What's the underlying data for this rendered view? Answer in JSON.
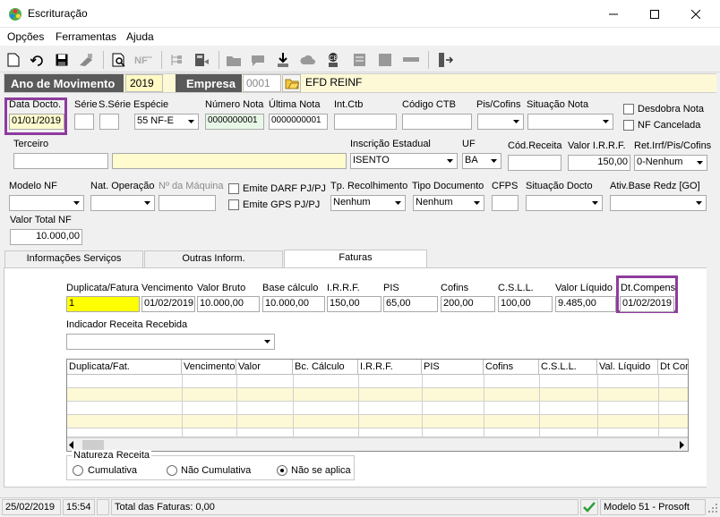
{
  "window": {
    "title": "Escrituração"
  },
  "menu": {
    "items": [
      "Opções",
      "Ferramentas",
      "Ajuda"
    ],
    "underline": [
      "O",
      "F",
      "A"
    ]
  },
  "anobar": {
    "ano_label": "Ano de Movimento",
    "ano_value": "2019",
    "empresa_label": "Empresa",
    "empresa_code": "0001",
    "empresa_name": "EFD REINF"
  },
  "form": {
    "data_docto_label": "Data Docto.",
    "data_docto": "01/01/2019",
    "serie_label": "Série",
    "sserie_label": "S.Série",
    "especie_label": "Espécie",
    "especie": "55 NF-E",
    "numero_nota_label": "Número Nota",
    "numero_nota": "0000000001",
    "ultima_nota_label": "Última Nota",
    "ultima_nota": "0000000001",
    "intctb_label": "Int.Ctb",
    "codigo_ctb_label": "Código CTB",
    "piscofins_label": "Pis/Cofins",
    "situacao_nota_label": "Situação Nota",
    "desdobra_nota_label": "Desdobra Nota",
    "nf_cancelada_label": "NF Cancelada",
    "terceiro_label": "Terceiro",
    "inscricao_label": "Inscrição Estadual",
    "inscricao": "ISENTO",
    "uf_label": "UF",
    "uf": "BA",
    "cod_receita_label": "Cód.Receita",
    "valor_irrf_label": "Valor I.R.R.F.",
    "valor_irrf": "150,00",
    "ret_irrf_label": "Ret.Irrf/Pis/Cofins",
    "ret_irrf": "0-Nenhum",
    "modelo_nf_label": "Modelo NF",
    "nat_operacao_label": "Nat. Operação",
    "n_maquina_label": "Nº da Máquina",
    "emite_darf_label": "Emite DARF PJ/PJ",
    "emite_gps_label": "Emite GPS PJ/PJ",
    "tp_recolhimento_label": "Tp. Recolhimento",
    "tp_recolhimento": "Nenhum",
    "tipo_documento_label": "Tipo Documento",
    "tipo_documento": "Nenhum",
    "cfps_label": "CFPS",
    "situacao_docto_label": "Situação Docto",
    "ativ_base_label": "Ativ.Base Redz [GO]",
    "valor_total_nf_label": "Valor Total NF",
    "valor_total_nf": "10.000,00"
  },
  "tabs": [
    {
      "label": "Informações Serviços",
      "underline": "I"
    },
    {
      "label": "Outras Inform.",
      "underline": "O"
    },
    {
      "label": "Faturas",
      "underline": "F"
    }
  ],
  "faturas": {
    "labels": {
      "duplicata": "Duplicata/Fatura",
      "vencimento": "Vencimento",
      "valor_bruto": "Valor Bruto",
      "base_calculo": "Base cálculo",
      "irrf": "I.R.R.F.",
      "pis": "PIS",
      "cofins": "Cofins",
      "csll": "C.S.L.L.",
      "valor_liquido": "Valor Líquido",
      "dt_compens": "Dt.Compens"
    },
    "values": {
      "duplicata": "1",
      "vencimento": "01/02/2019",
      "valor_bruto": "10.000,00",
      "base_calculo": "10.000,00",
      "irrf": "150,00",
      "pis": "65,00",
      "cofins": "200,00",
      "csll": "100,00",
      "valor_liquido": "9.485,00",
      "dt_compens": "01/02/2019"
    },
    "indicador_label": "Indicador Receita Recebida",
    "grid_columns": [
      "Duplicata/Fat.",
      "Vencimento",
      "Valor",
      "Bc. Cálculo",
      "I.R.R.F.",
      "PIS",
      "Cofins",
      "C.S.L.L.",
      "Val. Líquido",
      "Dt Comp"
    ],
    "natureza_label": "Natureza Receita",
    "natureza_options": [
      "Cumulativa",
      "Não Cumulativa",
      "Não se aplica"
    ],
    "natureza_selected": "Não se aplica"
  },
  "status": {
    "date": "25/02/2019",
    "time": "15:54",
    "total_faturas": "Total das Faturas: 0,00",
    "model": "Modelo 51 - Prosoft"
  },
  "colors": {
    "highlight_border": "#8e3c9e",
    "yellow_field": "#fffbcf",
    "dark_label": "#5a5a5a"
  }
}
